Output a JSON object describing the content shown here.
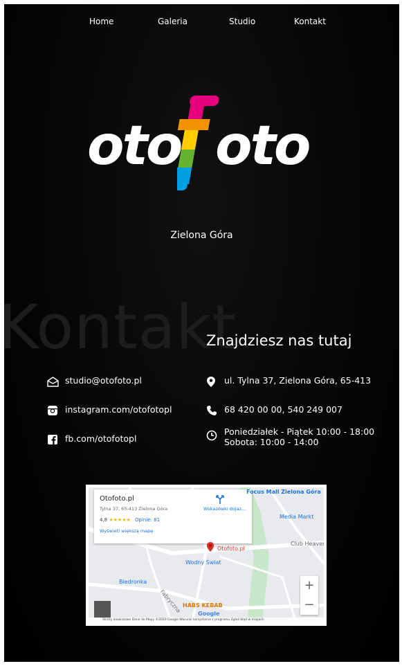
{
  "nav": {
    "items": [
      {
        "label": "Home"
      },
      {
        "label": "Galeria"
      },
      {
        "label": "Studio"
      },
      {
        "label": "Kontakt"
      }
    ]
  },
  "brand": {
    "logo_text": "otofoto",
    "colors": [
      "#e6007e",
      "#f39200",
      "#ffcc00",
      "#65b32e",
      "#009fe3"
    ]
  },
  "header": {
    "city": "Zielona Góra"
  },
  "section": {
    "background_word": "Kontakt",
    "title": "Znajdziesz nas tutaj"
  },
  "contact": {
    "email": "studio@otofoto.pl",
    "instagram": "instagram.com/otofotopl",
    "facebook": "fb.com/otofotopl",
    "address": "ul. Tylna 37, Zielona Góra, 65-413",
    "phone": "68 420 00 00,  540 249 007",
    "hours_weekdays": "Poniedziałek - Piątek 10:00 - 18:00",
    "hours_saturday": "Sobota: 10:00 - 14:00"
  },
  "map": {
    "place_name": "Otofoto.pl",
    "place_address": "Tylna 37, 65-413 Zielona Góra",
    "rating": "4,8",
    "stars": "★★★★★",
    "reviews": "Opinie: 81",
    "larger_map": "Wyświetl większą mapę",
    "directions": "Wskazówki dojaz...",
    "labels": {
      "focus": "Focus Mall Zielona Góra",
      "media": "Media Markt",
      "club": "Club Heaven",
      "otofoto": "Otofoto.pl",
      "wodny": "Wodny Świat",
      "biedronka": "Biedronka",
      "habs": "HABS KEBAB",
      "street": "Fabryczna"
    },
    "zoom_in": "+",
    "zoom_out": "−",
    "google": "Google",
    "footer": "Skróty klawiszowe   Dane do Mapy ©2020 Google   Warunki korzystania z programu   Zgłoś błąd w mapach"
  }
}
